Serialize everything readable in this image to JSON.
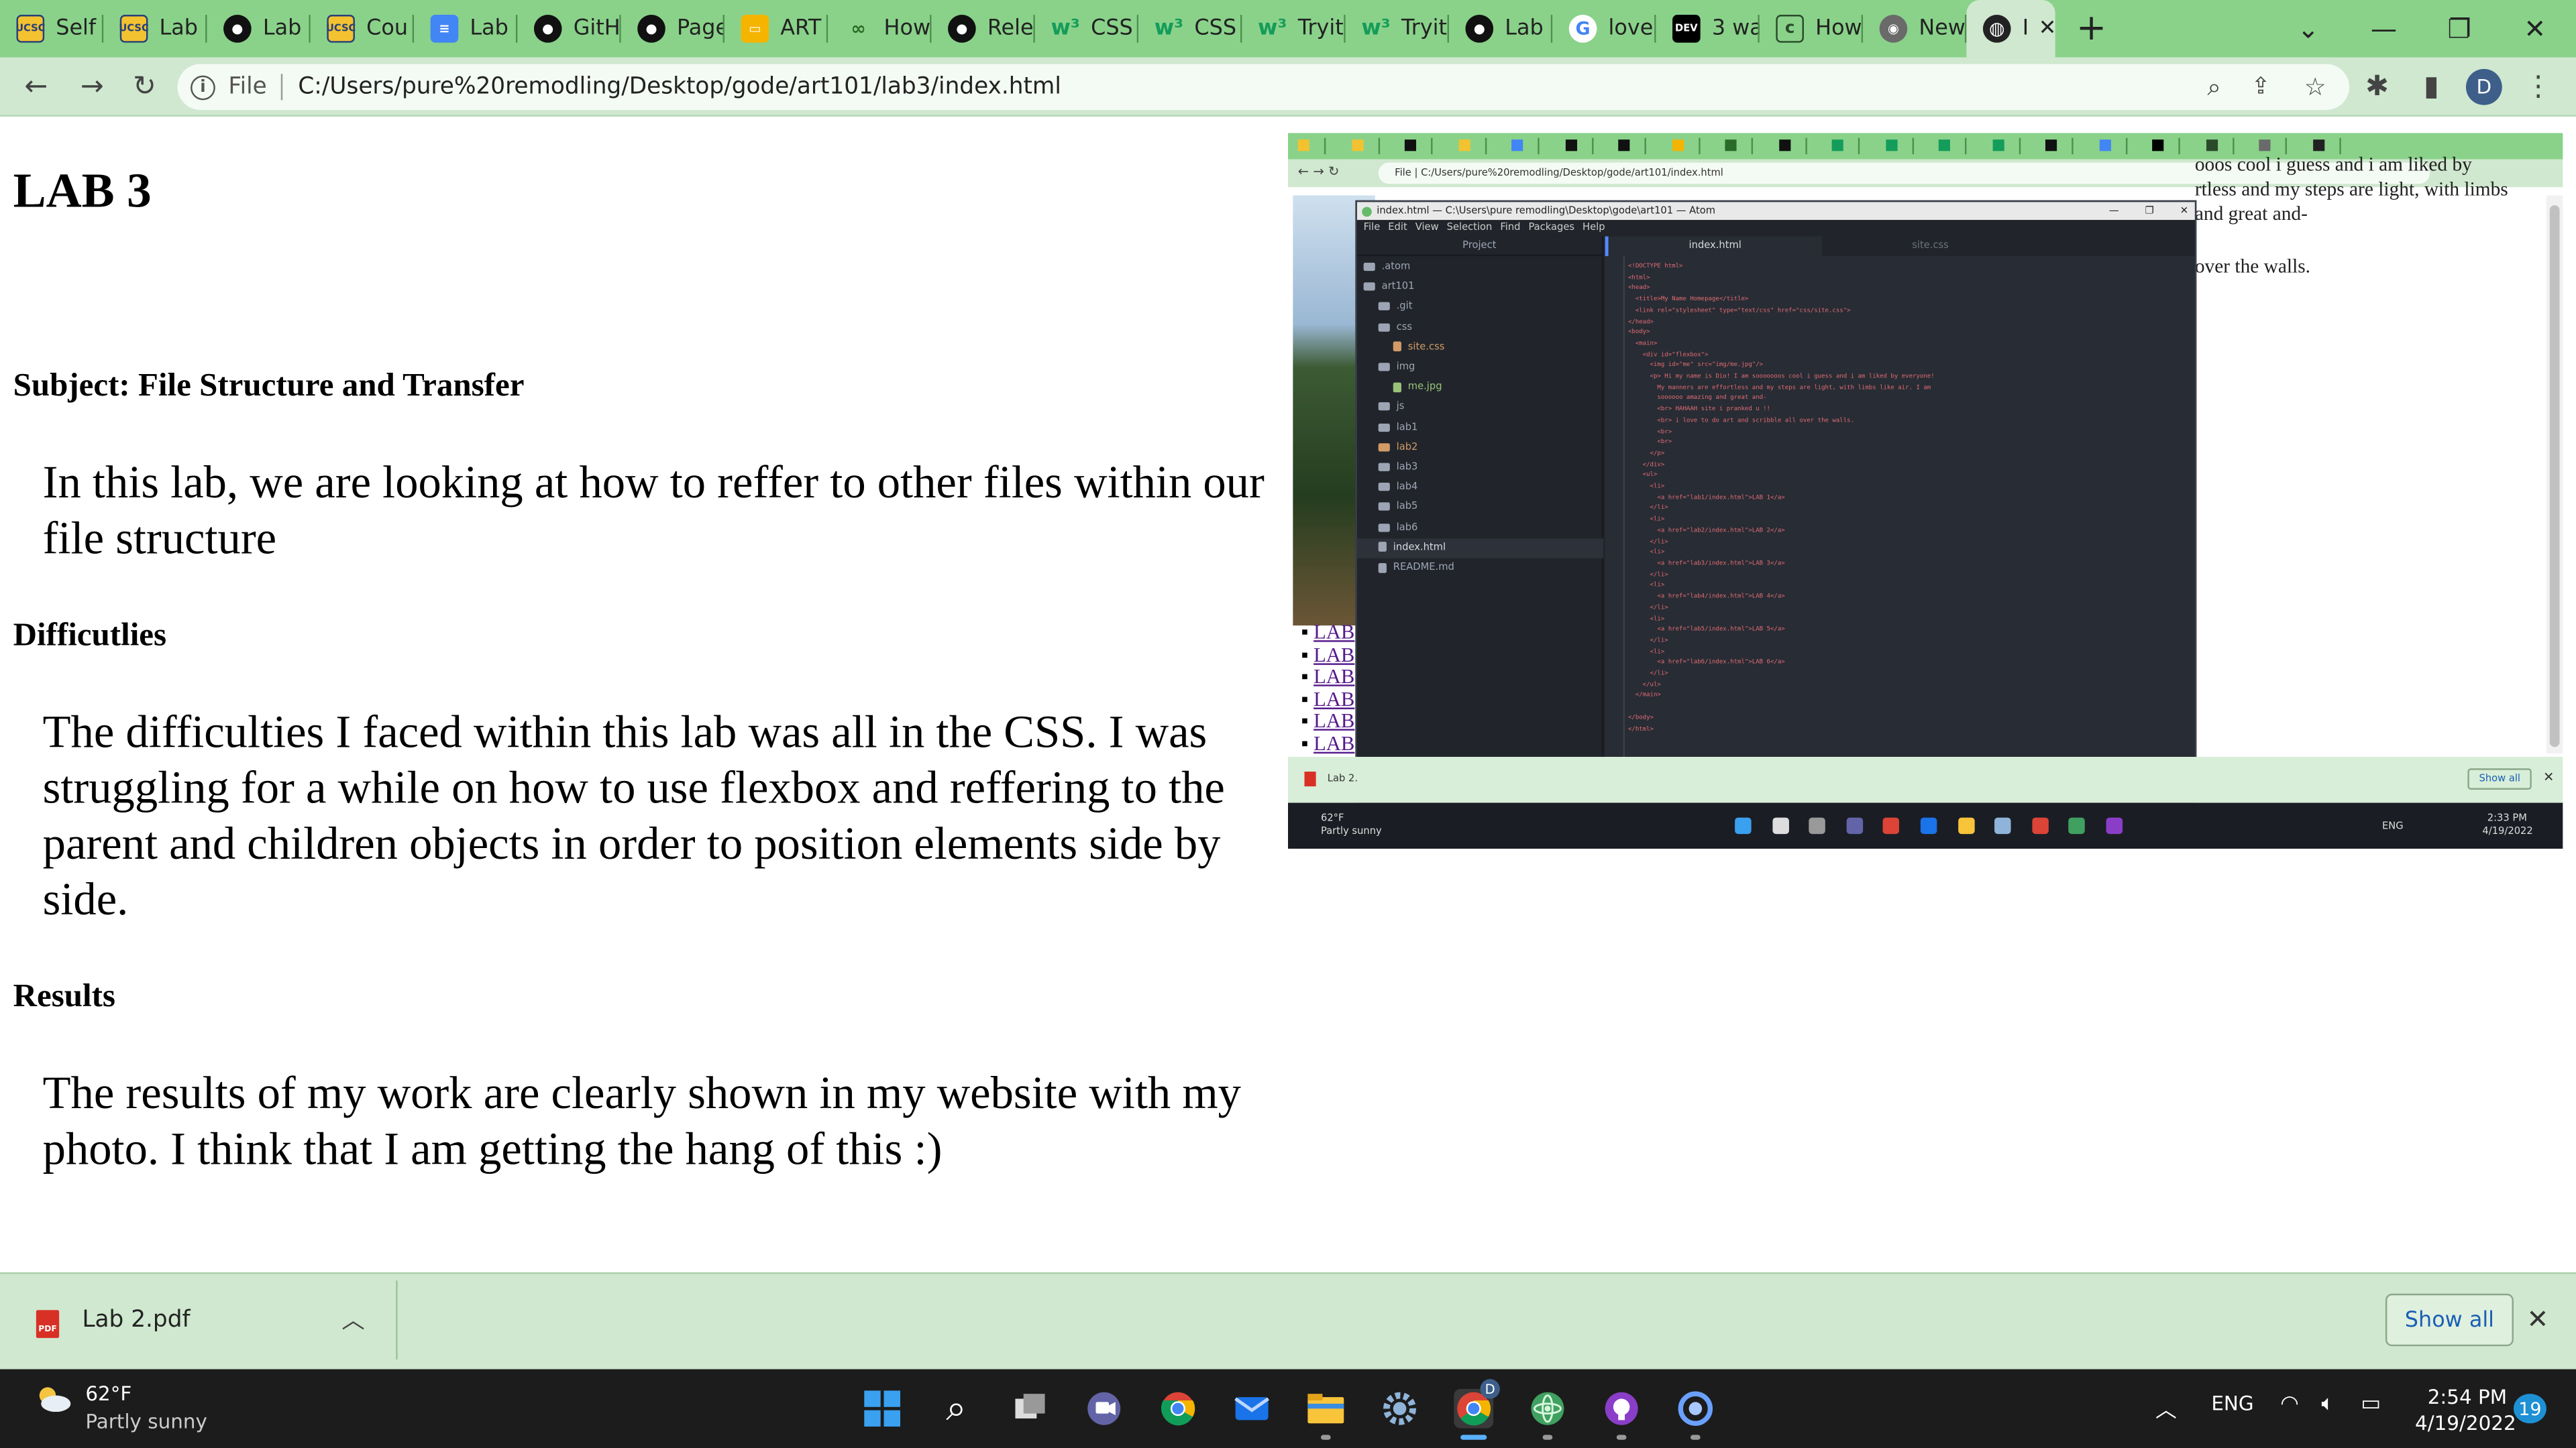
{
  "browser": {
    "tabs": [
      {
        "label": "Self",
        "icon": "ucsc-icon",
        "glyph": "UCSC",
        "cls": "ucsc"
      },
      {
        "label": "Lab",
        "icon": "ucsc-icon",
        "glyph": "UCSC",
        "cls": "ucsc"
      },
      {
        "label": "Lab",
        "icon": "github-icon",
        "glyph": "●",
        "cls": "gh"
      },
      {
        "label": "Cou",
        "icon": "ucsc-icon",
        "glyph": "UCSC",
        "cls": "ucsc"
      },
      {
        "label": "Lab",
        "icon": "docs-icon",
        "glyph": "≡",
        "cls": "doc"
      },
      {
        "label": "GitH",
        "icon": "github-icon",
        "glyph": "●",
        "cls": "gh"
      },
      {
        "label": "Page",
        "icon": "github-icon",
        "glyph": "●",
        "cls": "gh"
      },
      {
        "label": "ART",
        "icon": "slides-icon",
        "glyph": "▭",
        "cls": "art"
      },
      {
        "label": "How",
        "icon": "loop-icon",
        "glyph": "∞",
        "cls": "loop"
      },
      {
        "label": "Rele",
        "icon": "github-icon",
        "glyph": "●",
        "cls": "gh"
      },
      {
        "label": "CSS",
        "icon": "w3schools-icon",
        "glyph": "w³",
        "cls": "w3"
      },
      {
        "label": "CSS",
        "icon": "w3schools-icon",
        "glyph": "w³",
        "cls": "w3"
      },
      {
        "label": "Tryit",
        "icon": "w3schools-icon",
        "glyph": "w³",
        "cls": "w3"
      },
      {
        "label": "Tryit",
        "icon": "w3schools-icon",
        "glyph": "w³",
        "cls": "w3"
      },
      {
        "label": "Lab",
        "icon": "github-icon",
        "glyph": "●",
        "cls": "gh"
      },
      {
        "label": "love",
        "icon": "google-icon",
        "glyph": "G",
        "cls": "g"
      },
      {
        "label": "3 wa",
        "icon": "dev-icon",
        "glyph": "DEV",
        "cls": "dev"
      },
      {
        "label": "How",
        "icon": "codewars-icon",
        "glyph": "c",
        "cls": "cw"
      },
      {
        "label": "New",
        "icon": "newtab-icon",
        "glyph": "◉",
        "cls": "new"
      }
    ],
    "active_tab": {
      "label": "I",
      "icon": "globe-icon"
    },
    "address": {
      "scheme": "File",
      "url": "C:/Users/pure%20remodling/Desktop/gode/art101/lab3/index.html"
    },
    "profile_initial": "D",
    "accent": "#8ad28a"
  },
  "page": {
    "title": "LAB 3",
    "subject": "Subject: File Structure and Transfer",
    "intro": "In this lab, we are looking at how to reffer to other files within our file structure",
    "difficulties_heading": "Difficutlies",
    "difficulties": "The difficulties I faced within this lab was all in the CSS. I was struggling for a while on how to use flexbox and reffering to the parent and children objects in order to position elements side by side.",
    "results_heading": "Results",
    "results": "The results of my work are clearly shown in my website with my photo. I think that I am getting the hang of this :)"
  },
  "screenshot": {
    "address": "C:/Users/pure%20remodling/Desktop/gode/art101/index.html",
    "file_label": "File",
    "bio_lines": [
      "ooos cool i guess and i am liked by",
      "rtless and my steps are light, with limbs",
      "and great and-",
      "over the walls."
    ],
    "list_items": [
      "LAB",
      "LAB",
      "LAB",
      "LAB",
      "LAB",
      "LAB"
    ],
    "download": "Lab 2.",
    "show_all": "Show all",
    "weather": {
      "temp": "62°F",
      "condition": "Partly sunny"
    },
    "tray": {
      "lang": "ENG",
      "time": "2:33 PM",
      "date": "4/19/2022"
    },
    "atom": {
      "window_title": "index.html — C:\\Users\\pure remodling\\Desktop\\gode\\art101 — Atom",
      "menu": "File  Edit  View  Selection  Find  Packages  Help",
      "project_header": "Project",
      "tab_active": "index.html",
      "tab_other": "site.css",
      "tree": [
        {
          "label": ".atom",
          "kind": "folder",
          "depth": 0
        },
        {
          "label": "art101",
          "kind": "repo",
          "depth": 0
        },
        {
          "label": ".git",
          "kind": "folder",
          "depth": 1
        },
        {
          "label": "css",
          "kind": "folder-open",
          "depth": 1
        },
        {
          "label": "site.css",
          "kind": "file-ora",
          "depth": 2
        },
        {
          "label": "img",
          "kind": "folder-open",
          "depth": 1
        },
        {
          "label": "me.jpg",
          "kind": "file-grn",
          "depth": 2
        },
        {
          "label": "js",
          "kind": "folder",
          "depth": 1
        },
        {
          "label": "lab1",
          "kind": "folder",
          "depth": 1
        },
        {
          "label": "lab2",
          "kind": "folder-ora",
          "depth": 1
        },
        {
          "label": "lab3",
          "kind": "folder",
          "depth": 1
        },
        {
          "label": "lab4",
          "kind": "folder",
          "depth": 1
        },
        {
          "label": "lab5",
          "kind": "folder",
          "depth": 1
        },
        {
          "label": "lab6",
          "kind": "folder",
          "depth": 1
        },
        {
          "label": "index.html",
          "kind": "file-sel",
          "depth": 1
        },
        {
          "label": "README.md",
          "kind": "file",
          "depth": 1
        }
      ],
      "code": "<!DOCTYPE html>\n<html>\n<head>\n  <title>My Name Homepage</title>\n  <link rel=\"stylesheet\" type=\"text/css\" href=\"css/site.css\">\n</head>\n<body>\n  <main>\n    <div id=\"flexbox\">\n      <img id=\"me\" src=\"img/me.jpg\"/>\n      <p> Hi my name is Dio! I am sooooooos cool i guess and i am liked by everyone!\n        My manners are effortless and my steps are light, with limbs like air. I am\n        soooooo amazing and great and-\n        <br> HAHAAH site i pranked u !!\n        <br> i love to do art and scribble all over the walls.\n        <br>\n        <br>\n      </p>\n    </div>\n    <ul>\n      <li>\n        <a href=\"lab1/index.html\">LAB 1</a>\n      </li>\n      <li>\n        <a href=\"lab2/index.html\">LAB 2</a>\n      </li>\n      <li>\n        <a href=\"lab3/index.html\">LAB 3</a>\n      </li>\n      <li>\n        <a href=\"lab4/index.html\">LAB 4</a>\n      </li>\n      <li>\n        <a href=\"lab5/index.html\">LAB 5</a>\n      </li>\n      <li>\n        <a href=\"lab6/index.html\">LAB 6</a>\n      </li>\n    </ul>\n  </main>\n\n</body>\n</html>"
    }
  },
  "downloads": {
    "file": "Lab 2.pdf",
    "show_all": "Show all"
  },
  "taskbar": {
    "weather_temp": "62°F",
    "weather_condition": "Partly sunny",
    "lang": "ENG",
    "time": "2:54 PM",
    "date": "4/19/2022",
    "notifications": "19",
    "chrome_badge": "D"
  }
}
